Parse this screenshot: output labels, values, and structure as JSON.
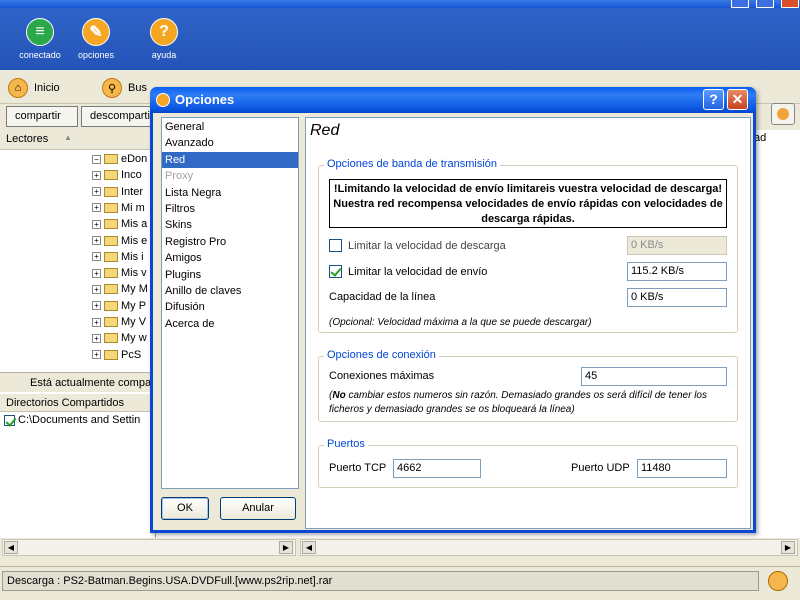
{
  "app": {
    "toolbar": [
      {
        "label": "conectado",
        "icon": "network-icon",
        "color": "#2aa84a"
      },
      {
        "label": "opciones",
        "icon": "wrench-icon",
        "color": "#f5a623"
      },
      {
        "label": "ayuda",
        "icon": "help-icon",
        "color": "#f5a623"
      }
    ],
    "nav": [
      {
        "label": "Inicio",
        "icon": "home-icon"
      },
      {
        "label": "Bus",
        "icon": "search-icon"
      }
    ],
    "tabs": [
      "compartir",
      "descompartir"
    ],
    "left_panel": {
      "header": "Lectores",
      "tree": [
        "eDon",
        "Inco",
        "Inter",
        "Mi m",
        "Mis a",
        "Mis e",
        "Mis i",
        "Mis v",
        "My M",
        "My P",
        "My V",
        "My w",
        "PcS"
      ],
      "status_note": "Está actualmente compa",
      "dirs_header": "Directorios Compartidos",
      "dirs_item": "C:\\Documents and Settin"
    },
    "right_header": "ad",
    "status_bar": "Descarga : PS2-Batman.Begins.USA.DVDFull.[www.ps2rip.net].rar"
  },
  "dialog": {
    "title": "Opciones",
    "help_glyph": "?",
    "close_glyph": "✕",
    "categories": [
      {
        "label": "General",
        "state": "normal"
      },
      {
        "label": "Avanzado",
        "state": "normal"
      },
      {
        "label": "Red",
        "state": "selected"
      },
      {
        "label": "Proxy",
        "state": "disabled"
      },
      {
        "label": "Lista Negra",
        "state": "normal"
      },
      {
        "label": "Filtros",
        "state": "normal"
      },
      {
        "label": "Skins",
        "state": "normal"
      },
      {
        "label": "Registro Pro",
        "state": "normal"
      },
      {
        "label": "Amigos",
        "state": "normal"
      },
      {
        "label": "Plugins",
        "state": "normal"
      },
      {
        "label": "Anillo de claves",
        "state": "normal"
      },
      {
        "label": "Difusión",
        "state": "normal"
      },
      {
        "label": "Acerca de",
        "state": "normal"
      }
    ],
    "ok_label": "OK",
    "cancel_label": "Anular",
    "section_title": "Red",
    "bandwidth": {
      "legend": "Opciones de banda de transmisión",
      "warning": "!Limitando la velocidad de envío limitareis vuestra velocidad de descarga! Nuestra red recompensa velocidades de envío rápidas con velocidades de descarga rápidas.",
      "limit_download_label": "Limitar la velocidad de descarga",
      "limit_download_checked": false,
      "limit_download_value": "0 KB/s",
      "limit_upload_label": "Limitar la velocidad de envío",
      "limit_upload_checked": true,
      "limit_upload_value": "115.2 KB/s",
      "line_capacity_label": "Capacidad de la línea",
      "line_capacity_value": "0 KB/s",
      "note": "(Opcional: Velocidad máxima a la que se puede descargar)"
    },
    "connection": {
      "legend": "Opciones de conexión",
      "max_connections_label": "Conexiones máximas",
      "max_connections_value": "45",
      "note_bold": "No",
      "note_rest": " cambiar estos numeros sin razón. Demasiado grandes os será difícil de tener los ficheros y demasiado grandes se os bloqueará la línea)",
      "note_open": "("
    },
    "ports": {
      "legend": "Puertos",
      "tcp_label": "Puerto TCP",
      "tcp_value": "4662",
      "udp_label": "Puerto UDP",
      "udp_value": "11480"
    }
  }
}
